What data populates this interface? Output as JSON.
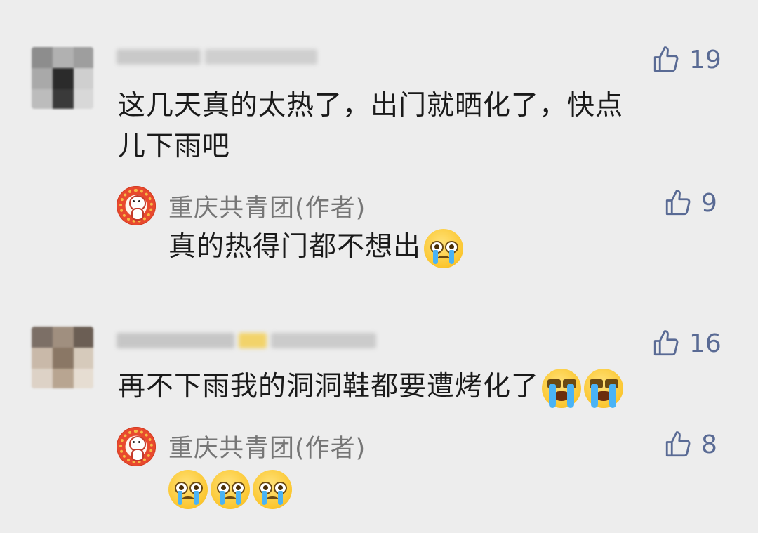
{
  "comments": [
    {
      "username": "",
      "likes": "19",
      "text": "这几天真的太热了，出门就晒化了，快点\n儿下雨吧",
      "reply": {
        "author": "重庆共青团(作者)",
        "likes": "9",
        "text": "真的热得门都不想出",
        "emojis": [
          "crying-face-emoji"
        ]
      }
    },
    {
      "username": "",
      "likes": "16",
      "text": "再不下雨我的洞洞鞋都要遭烤化了",
      "emojis": [
        "loudly-crying-face-emoji",
        "loudly-crying-face-emoji"
      ],
      "reply": {
        "author": "重庆共青团(作者)",
        "likes": "8",
        "text": "",
        "emojis": [
          "crying-face-emoji",
          "crying-face-emoji",
          "crying-face-emoji"
        ]
      }
    }
  ],
  "icons": {
    "like": "thumbs-up-icon"
  },
  "colors": {
    "background": "#ededed",
    "like_color": "#596a94",
    "author_name": "#767676",
    "text": "#1a1a1a"
  }
}
